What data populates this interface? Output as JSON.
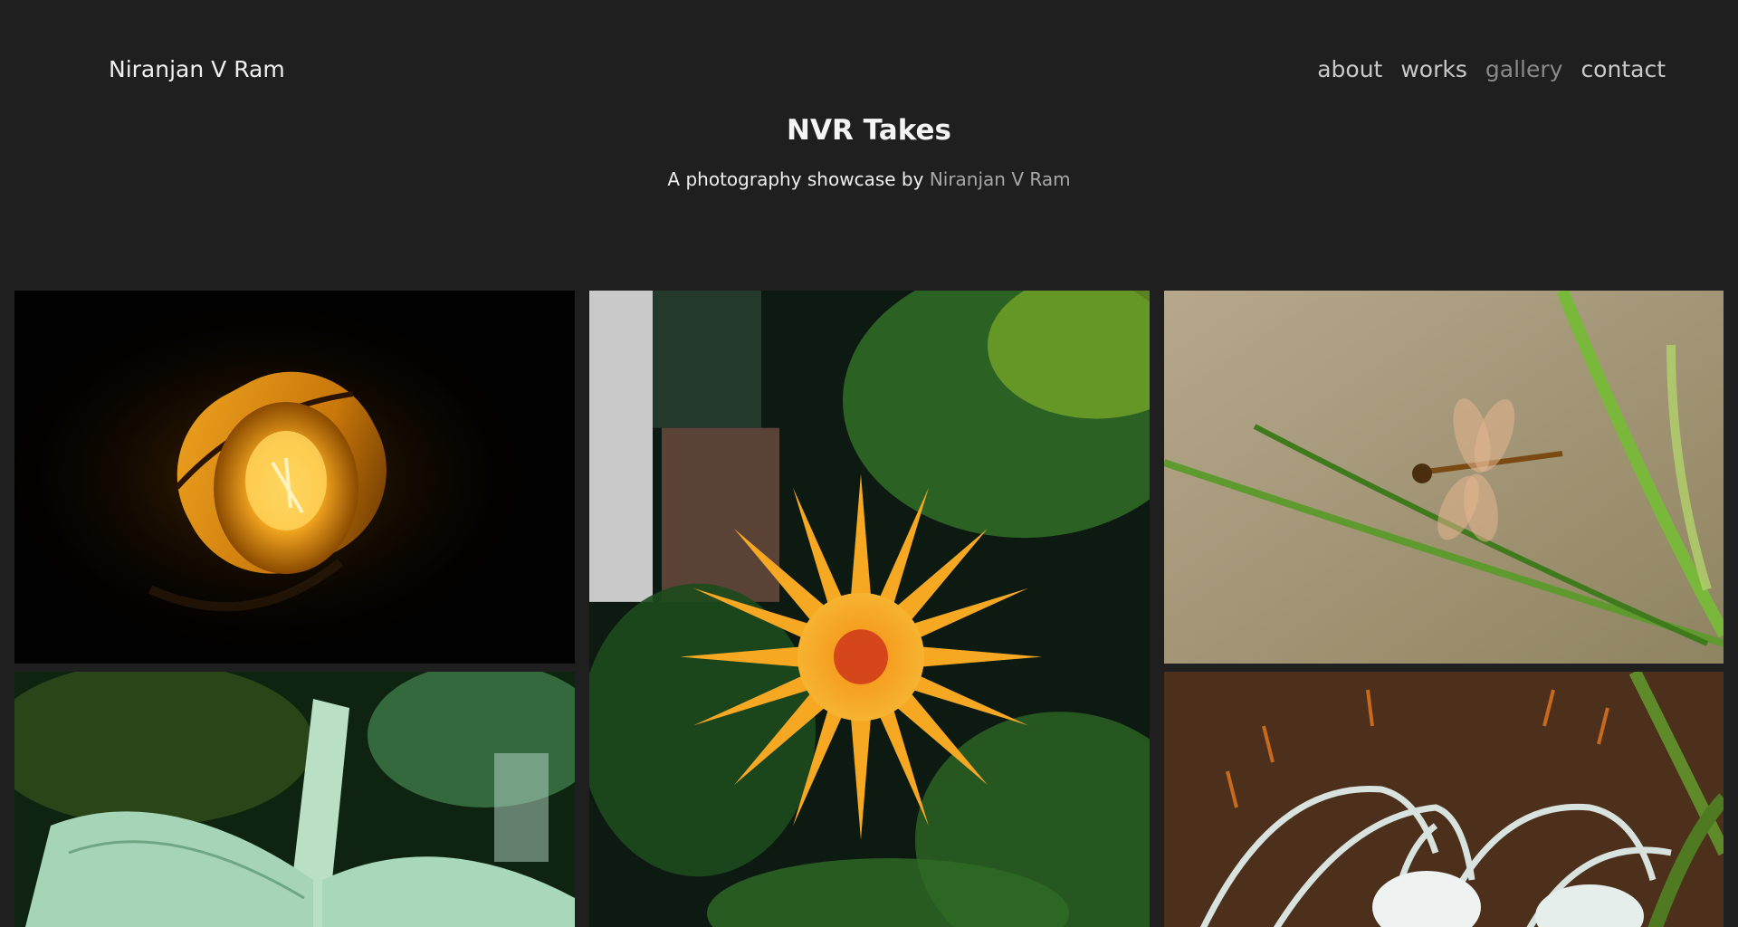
{
  "header": {
    "brand": "Niranjan V Ram",
    "nav": [
      {
        "label": "about",
        "active": false
      },
      {
        "label": "works",
        "active": false
      },
      {
        "label": "gallery",
        "active": true
      },
      {
        "label": "contact",
        "active": false
      }
    ]
  },
  "hero": {
    "title": "NVR Takes",
    "subtitle_prefix": "A photography showcase by",
    "subtitle_link": "Niranjan V Ram"
  },
  "gallery": {
    "photos": [
      {
        "subject": "glowing lamp"
      },
      {
        "subject": "orange flower"
      },
      {
        "subject": "dragonfly on grass"
      },
      {
        "subject": "open book"
      },
      {
        "subject": "white spider lily"
      }
    ]
  },
  "colors": {
    "background": "#1f1f1f",
    "text": "#ececec",
    "nav_text": "#c9c9c9",
    "nav_active": "#8a8a8a",
    "link_muted": "#a8a8a8"
  }
}
